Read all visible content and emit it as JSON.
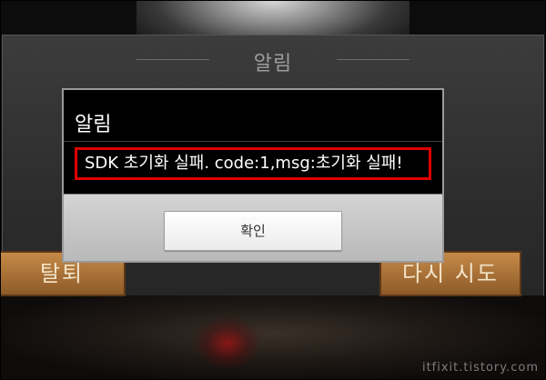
{
  "background": {
    "panel_title": "알림",
    "left_button": "탈퇴",
    "right_button": "다시 시도",
    "watermark": "itfixit.tistory.com"
  },
  "dialog": {
    "title": "알림",
    "message": "SDK 초기화 실패. code:1,msg:초기화 실패!",
    "ok_label": "확인"
  },
  "colors": {
    "highlight_border": "#e00000",
    "background_button": "#a86f38",
    "dialog_background": "#000000"
  }
}
